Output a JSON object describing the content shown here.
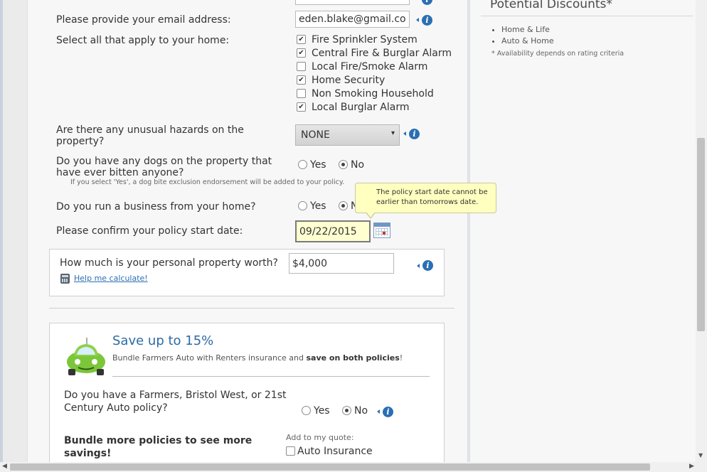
{
  "sidebar": {
    "title": "Potential Discounts*",
    "items": [
      "Home & Life",
      "Auto & Home"
    ],
    "note": "* Availability depends on rating criteria"
  },
  "form": {
    "email": {
      "label": "Please provide your email address:",
      "value": "eden.blake@gmail.com"
    },
    "home_features": {
      "label": "Select all that apply to your home:",
      "options": [
        {
          "label": "Fire Sprinkler System",
          "checked": true
        },
        {
          "label": "Central Fire & Burglar Alarm",
          "checked": true
        },
        {
          "label": "Local Fire/Smoke Alarm",
          "checked": false
        },
        {
          "label": "Home Security",
          "checked": true
        },
        {
          "label": "Non Smoking Household",
          "checked": false
        },
        {
          "label": "Local Burglar Alarm",
          "checked": true
        }
      ]
    },
    "hazards": {
      "label": "Are there any unusual hazards on the property?",
      "selected": "NONE",
      "arrow": "▾"
    },
    "dogs": {
      "label": "Do you have any dogs on the property that have ever bitten anyone?",
      "yes": "Yes",
      "no": "No",
      "selected": "No",
      "note": "If you select 'Yes', a dog bite exclusion endorsement will be added to your policy."
    },
    "business": {
      "label": "Do you run a business from your home?",
      "yes": "Yes",
      "no": "No",
      "selected": "No"
    },
    "start_date": {
      "label": "Please confirm your policy start date:",
      "value": "09/22/2015"
    },
    "tooltip": "The policy start date cannot be earlier than tomorrows date.",
    "property": {
      "label": "How much is your personal property worth?",
      "value": "$4,000",
      "help_link": "Help me calculate!"
    }
  },
  "promo": {
    "title": "Save up to 15%",
    "subtitle_pre": "Bundle Farmers Auto with Renters insurance and ",
    "subtitle_bold": "save on both policies",
    "subtitle_post": "!",
    "auto_q": {
      "label": "Do you have a Farmers, Bristol West, or 21st Century Auto policy?",
      "yes": "Yes",
      "no": "No",
      "selected": "No"
    },
    "bundle_label": "Bundle more policies to see more savings!",
    "add_label": "Add to my quote:",
    "auto_option": {
      "label": "Auto Insurance",
      "checked": false
    }
  },
  "colors": {
    "accent": "#2a6fb3",
    "tooltip_bg": "#ffffc0",
    "car": "#7cc63a"
  },
  "icons": {
    "info": "info-icon",
    "calendar": "calendar-icon",
    "calculator": "calculator-icon",
    "car": "car-icon"
  }
}
